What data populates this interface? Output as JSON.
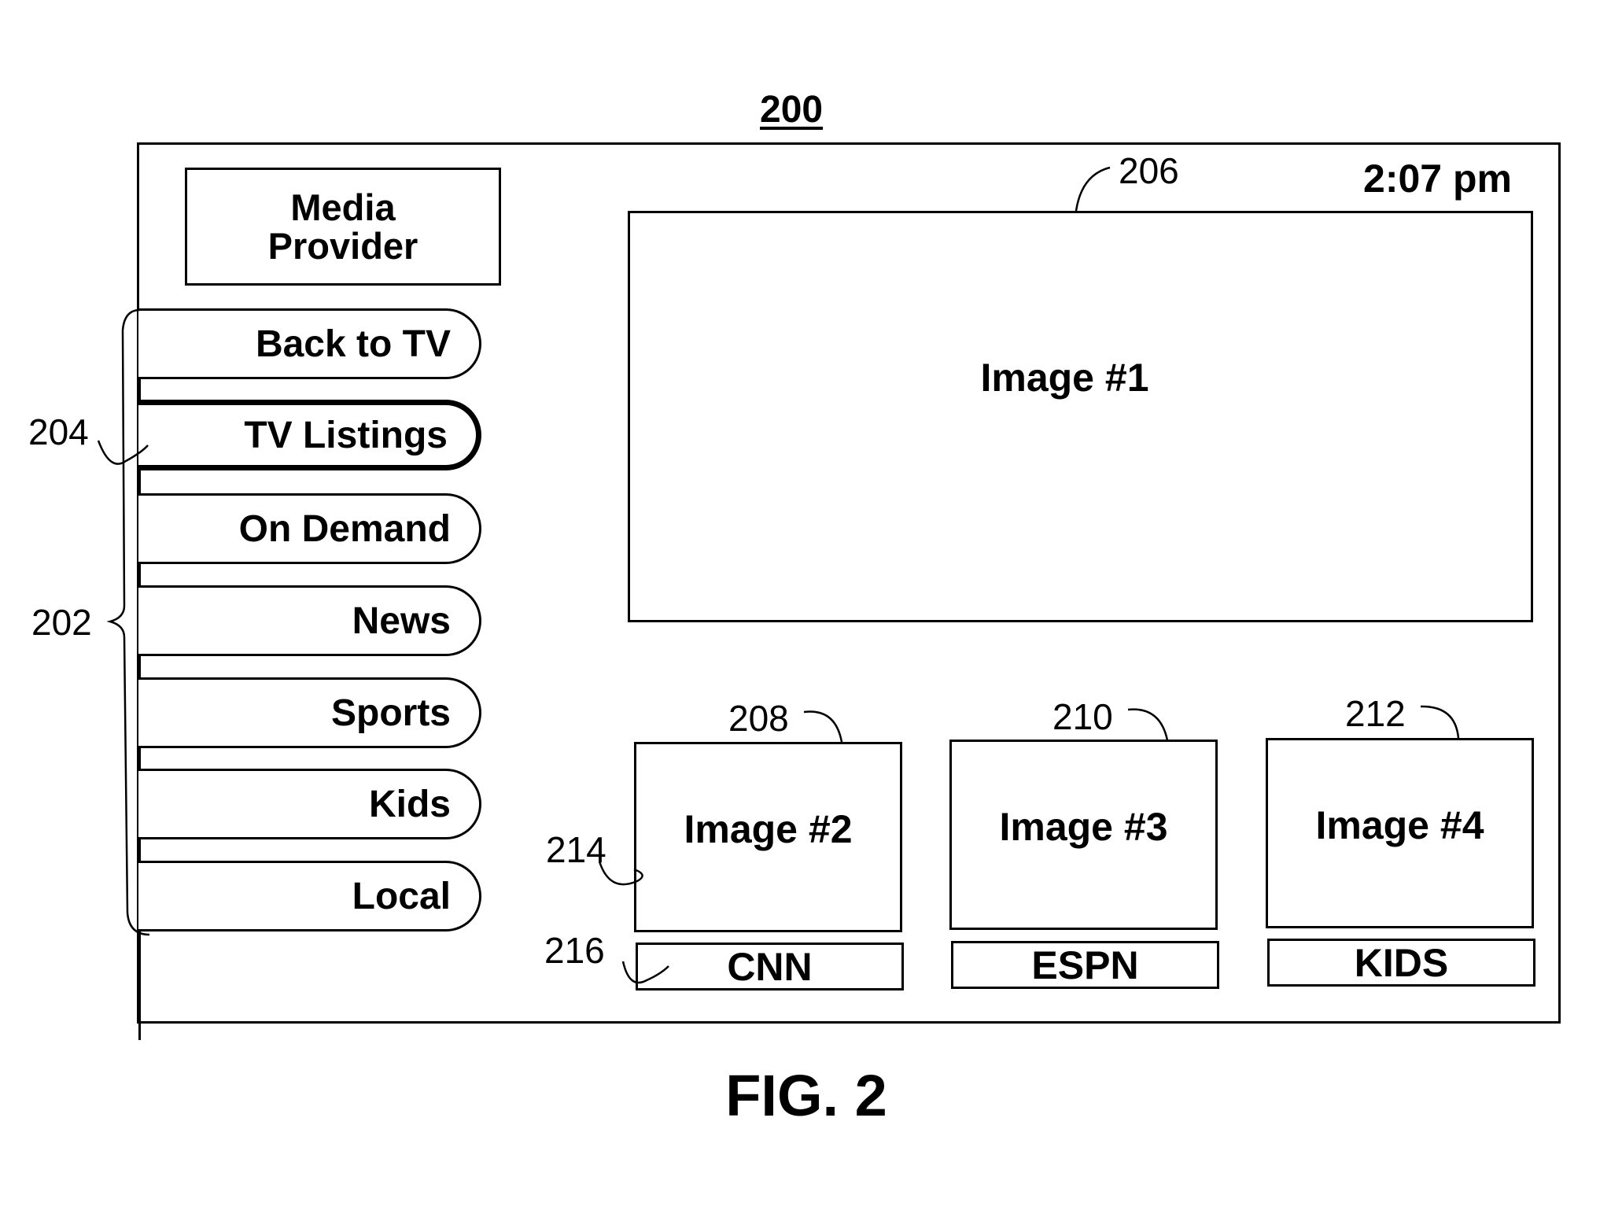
{
  "figure": {
    "number_label": "200",
    "caption": "FIG. 2"
  },
  "screen": {
    "provider_label": "Media\nProvider",
    "clock": "2:07 pm",
    "menu": {
      "items": [
        {
          "label": "Back to TV",
          "selected": false
        },
        {
          "label": "TV Listings",
          "selected": true
        },
        {
          "label": "On Demand",
          "selected": false
        },
        {
          "label": "News",
          "selected": false
        },
        {
          "label": "Sports",
          "selected": false
        },
        {
          "label": "Kids",
          "selected": false
        },
        {
          "label": "Local",
          "selected": false
        }
      ]
    },
    "main_image": {
      "label": "Image #1"
    },
    "thumbnails": [
      {
        "label": "Image #2",
        "channel": "CNN"
      },
      {
        "label": "Image #3",
        "channel": "ESPN"
      },
      {
        "label": "Image #4",
        "channel": "KIDS"
      }
    ]
  },
  "reference_numerals": {
    "menu_group": "202",
    "selected_item": "204",
    "main_image": "206",
    "thumb_1": "208",
    "thumb_2": "210",
    "thumb_3": "212",
    "thumb_image": "214",
    "channel_label": "216"
  }
}
